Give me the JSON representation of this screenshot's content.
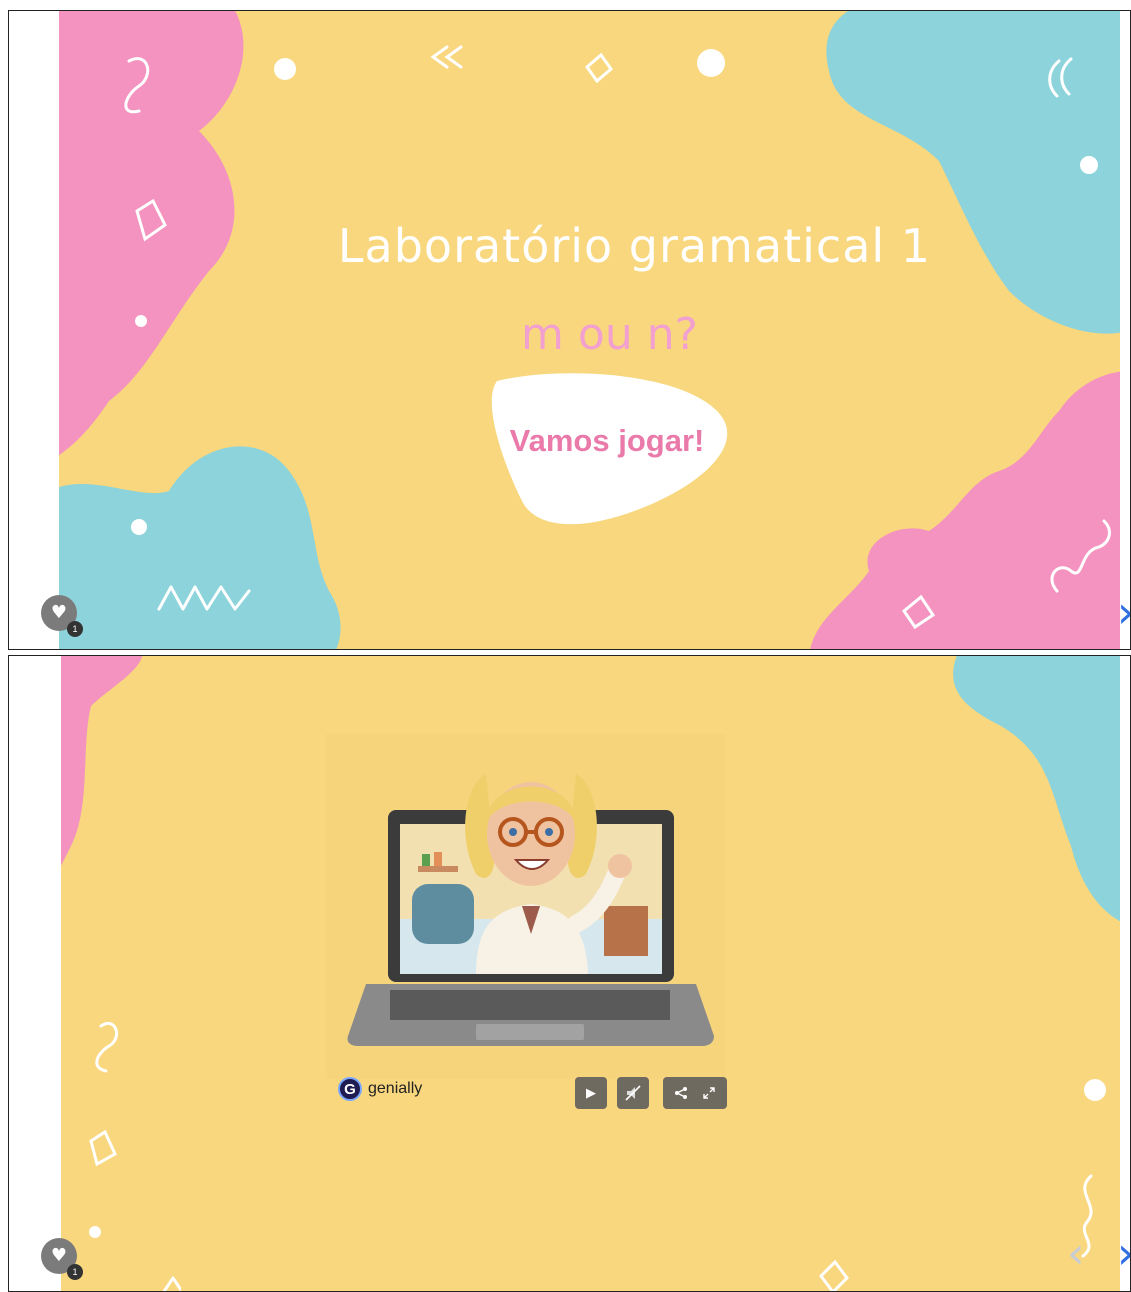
{
  "slide1": {
    "title": "Laboratório gramatical 1",
    "subtitle": "m ou n?",
    "button_label": "Vamos jogar!",
    "like_count": "1",
    "next_arrow": "›"
  },
  "slide2": {
    "brand": "genially",
    "brand_icon": "G",
    "like_count": "1",
    "prev_arrow": "‹",
    "next_arrow": "›",
    "controls": {
      "play_icon": "play-icon",
      "mute_icon": "mute-icon",
      "share_icon": "share-icon",
      "fullscreen_icon": "fullscreen-icon"
    }
  },
  "colors": {
    "background": "#f8d77e",
    "pink": "#f493bf",
    "teal": "#8dd3db",
    "title_white": "#ffffff",
    "subtitle_pink": "#f2a0d0",
    "button_text": "#e97aa9",
    "arrow_blue": "#2f6fe0"
  }
}
